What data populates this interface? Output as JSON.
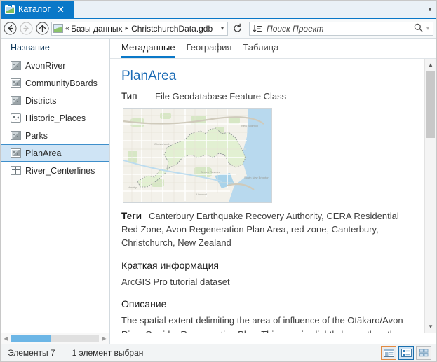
{
  "window": {
    "tab_label": "Каталог",
    "tab_icon": "catalog-icon",
    "close_label": "✕",
    "overflow_caret": "▾"
  },
  "navbar": {
    "back_icon": "back-arrow-icon",
    "forward_icon": "forward-arrow-icon",
    "up_icon": "up-arrow-icon",
    "breadcrumb": {
      "root_icon": "geodatabase-icon",
      "overflow": "«",
      "items": [
        "Базы данных",
        "ChristchurchData.gdb"
      ],
      "separator": "▸",
      "caret": "▾"
    },
    "refresh_icon": "refresh-icon",
    "sort_icon": "sort-icon",
    "search": {
      "placeholder": "Поиск Проект",
      "value": "",
      "icon": "search-icon",
      "caret": "▾"
    }
  },
  "tree": {
    "header": "Название",
    "items": [
      {
        "label": "AvonRiver",
        "icon": "polygon-feature-icon",
        "selected": false
      },
      {
        "label": "CommunityBoards",
        "icon": "polygon-feature-icon",
        "selected": false
      },
      {
        "label": "Districts",
        "icon": "polygon-feature-icon",
        "selected": false
      },
      {
        "label": "Historic_Places",
        "icon": "point-feature-icon",
        "selected": false
      },
      {
        "label": "Parks",
        "icon": "polygon-feature-icon",
        "selected": false
      },
      {
        "label": "PlanArea",
        "icon": "polygon-feature-icon",
        "selected": true
      },
      {
        "label": "River_Centerlines",
        "icon": "line-feature-icon",
        "selected": false
      }
    ]
  },
  "content": {
    "tabs": [
      {
        "label": "Метаданные",
        "active": true
      },
      {
        "label": "География",
        "active": false
      },
      {
        "label": "Таблица",
        "active": false
      }
    ],
    "title": "PlanArea",
    "type_label": "Тип",
    "type_value": "File Geodatabase Feature Class",
    "thumbnail_alt": "map-thumbnail",
    "tags_label": "Теги",
    "tags_value": "Canterbury Earthquake Recovery Authority, CERA Residential Red Zone, Avon Regeneration Plan Area, red zone, Canterbury, Christchurch, New Zealand",
    "summary_label": "Краткая информация",
    "summary_value": "ArcGIS Pro tutorial dataset",
    "description_label": "Описание",
    "description_value": "The spatial extent delimiting the area of influence of the Ōtākaro/Avon River Corridor Regeneration Plan. This area is slightly larger than the"
  },
  "status": {
    "items_count": "Элементы 7",
    "selection": "1 элемент выбран",
    "view_buttons": [
      {
        "name": "details-view-button",
        "state": "highlighted"
      },
      {
        "name": "list-view-button",
        "state": "selected"
      },
      {
        "name": "tile-view-button",
        "state": "normal"
      }
    ]
  },
  "colors": {
    "accent": "#0a78c8",
    "title_link": "#1b6bb5",
    "selection_fill": "#cfe4f5",
    "selection_border": "#3e8fcb",
    "scroll_thumb": "#6cb6e6",
    "highlight_orange": "#e08a42"
  }
}
